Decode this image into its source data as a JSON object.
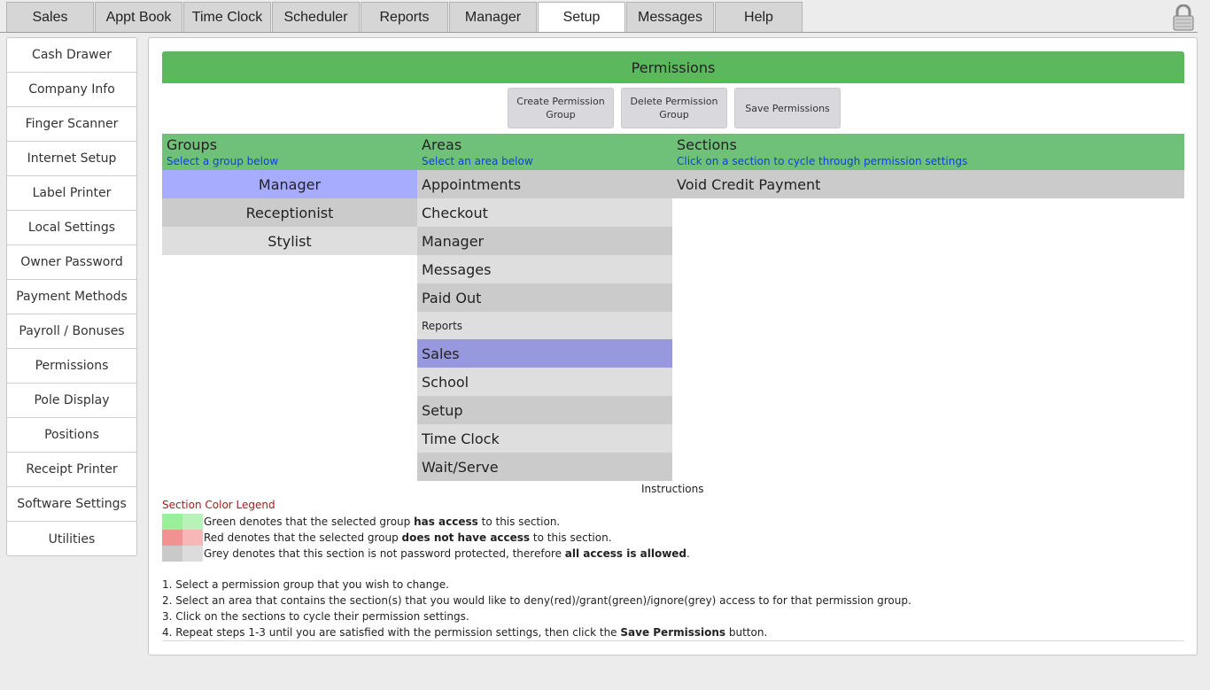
{
  "tabs": [
    "Sales",
    "Appt Book",
    "Time Clock",
    "Scheduler",
    "Reports",
    "Manager",
    "Setup",
    "Messages",
    "Help"
  ],
  "active_tab": "Setup",
  "sidebar": [
    "Cash Drawer",
    "Company Info",
    "Finger Scanner",
    "Internet Setup",
    "Label Printer",
    "Local Settings",
    "Owner Password",
    "Payment Methods",
    "Payroll / Bonuses",
    "Permissions",
    "Pole Display",
    "Positions",
    "Receipt Printer",
    "Software Settings",
    "Utilities"
  ],
  "panel": {
    "title": "Permissions",
    "buttons": {
      "create": "Create Permission Group",
      "delete": "Delete Permission Group",
      "save": "Save Permissions"
    },
    "columns": {
      "groups": {
        "title": "Groups",
        "hint": "Select a group below"
      },
      "areas": {
        "title": "Areas",
        "hint": "Select an area below"
      },
      "sections": {
        "title": "Sections",
        "hint": "Click on a section to cycle through permission settings"
      }
    },
    "groups": [
      "Manager",
      "Receptionist",
      "Stylist"
    ],
    "selected_group": "Manager",
    "areas": [
      "Appointments",
      "Checkout",
      "Manager",
      "Messages",
      "Paid Out",
      "Reports",
      "Sales",
      "School",
      "Setup",
      "Time Clock",
      "Wait/Serve"
    ],
    "selected_area": "Sales",
    "sections": [
      "Void Credit Payment"
    ],
    "instructions_title": "Instructions",
    "legend": {
      "title": "Section Color Legend",
      "green": {
        "pre": "Green denotes that the selected group ",
        "bold": "has access",
        "post": " to this section."
      },
      "red": {
        "pre": "Red denotes that the selected group ",
        "bold": "does not have access",
        "post": " to this section."
      },
      "grey": {
        "pre": "Grey denotes that this section is not password protected, therefore ",
        "bold": "all access is allowed",
        "post": "."
      }
    },
    "steps": [
      "1. Select a permission group that you wish to change.",
      "2. Select an area that contains the section(s) that you would like to deny(red)/grant(green)/ignore(grey) access to for that permission group.",
      "3. Click on the sections to cycle their permission settings."
    ],
    "step4": {
      "pre": "4. Repeat steps 1-3 until you are satisfied with the permission settings, then click the ",
      "bold": "Save Permissions",
      "post": " button."
    }
  },
  "colors": {
    "header_green": "#5cb85c",
    "column_green": "#6fc179",
    "selected_group": "#a7acff",
    "selected_area": "#9898de",
    "legend_green": [
      "#99f099",
      "#b9f2b9"
    ],
    "legend_red": [
      "#f29191",
      "#f7b7b7"
    ],
    "legend_grey": [
      "#c9c9c9",
      "#dcdcdc"
    ]
  }
}
